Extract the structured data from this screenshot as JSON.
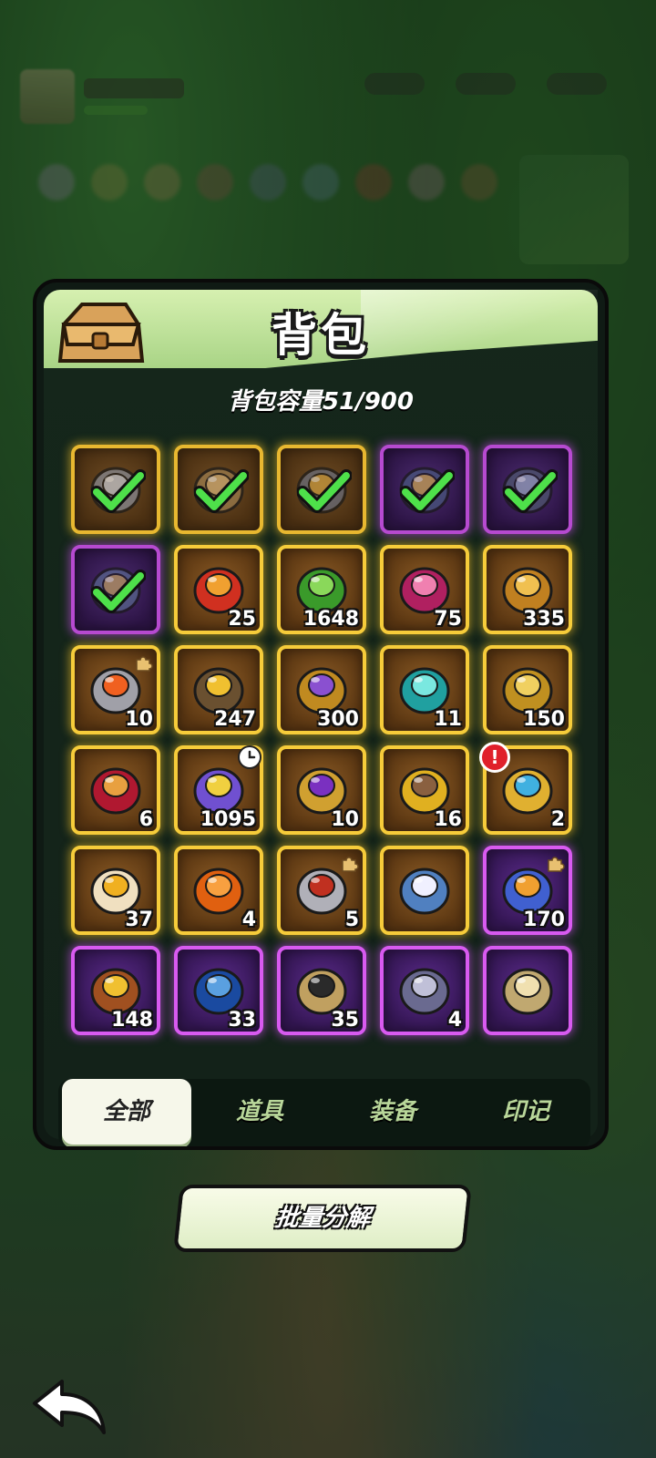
{
  "panel": {
    "title": "背包",
    "capacity": "背包容量51/900"
  },
  "items": [
    {
      "icon": "sword-icon",
      "rarity": "gold",
      "equipped": true,
      "count": ""
    },
    {
      "icon": "shoulder-armor-icon",
      "rarity": "gold",
      "equipped": true,
      "count": ""
    },
    {
      "icon": "helmet-icon",
      "rarity": "gold",
      "equipped": true,
      "count": ""
    },
    {
      "icon": "gauntlet-icon",
      "rarity": "purple",
      "equipped": true,
      "count": ""
    },
    {
      "icon": "chest-armor-icon",
      "rarity": "purple",
      "equipped": true,
      "count": ""
    },
    {
      "icon": "boots-icon",
      "rarity": "purple",
      "equipped": true,
      "count": ""
    },
    {
      "icon": "orb-icon",
      "rarity": "gold",
      "count": "25"
    },
    {
      "icon": "green-heart-icon",
      "rarity": "gold",
      "count": "1648"
    },
    {
      "icon": "crystal-icon",
      "rarity": "gold",
      "count": "75"
    },
    {
      "icon": "emblem-icon",
      "rarity": "gold",
      "count": "335"
    },
    {
      "icon": "flame-helm-icon",
      "rarity": "gold",
      "count": "10",
      "badge": "puzzle"
    },
    {
      "icon": "star-medal-icon",
      "rarity": "gold",
      "count": "247"
    },
    {
      "icon": "gold-coin-icon",
      "rarity": "gold",
      "count": "300"
    },
    {
      "icon": "cyan-heart-icon",
      "rarity": "gold",
      "count": "11"
    },
    {
      "icon": "puzzle-piece-icon",
      "rarity": "gold",
      "count": "150"
    },
    {
      "icon": "ruby-icon",
      "rarity": "gold",
      "count": "6"
    },
    {
      "icon": "star-orb-icon",
      "rarity": "gold",
      "count": "1095",
      "badge": "clock"
    },
    {
      "icon": "amethyst-key-icon",
      "rarity": "gold",
      "count": "10"
    },
    {
      "icon": "pickaxe-icon",
      "rarity": "gold",
      "count": "16"
    },
    {
      "icon": "scepter-icon",
      "rarity": "gold",
      "count": "2",
      "badge": "alert"
    },
    {
      "icon": "lotus-icon",
      "rarity": "gold",
      "count": "37"
    },
    {
      "icon": "orange-heart-icon",
      "rarity": "gold",
      "count": "4"
    },
    {
      "icon": "axe-icon",
      "rarity": "gold",
      "count": "5",
      "badge": "puzzle"
    },
    {
      "icon": "flower-icon",
      "rarity": "gold",
      "count": ""
    },
    {
      "icon": "shuriken-icon",
      "rarity": "purple",
      "count": "170",
      "badge": "puzzle"
    },
    {
      "icon": "trophy-icon",
      "rarity": "purple",
      "count": "148"
    },
    {
      "icon": "blue-ball-icon",
      "rarity": "purple",
      "count": "33"
    },
    {
      "icon": "paw-bell-icon",
      "rarity": "purple",
      "count": "35"
    },
    {
      "icon": "ingot-icon",
      "rarity": "purple",
      "count": "4"
    },
    {
      "icon": "stone-icon",
      "rarity": "purple",
      "count": ""
    }
  ],
  "tabs": [
    {
      "label": "全部",
      "active": true
    },
    {
      "label": "道具",
      "active": false
    },
    {
      "label": "装备",
      "active": false
    },
    {
      "label": "印记",
      "active": false
    }
  ],
  "batch_button": "批量分解",
  "colors": {
    "gold_border": "#f6cc3a",
    "purple_border": "#d85af0",
    "header": "#bfe39b"
  }
}
